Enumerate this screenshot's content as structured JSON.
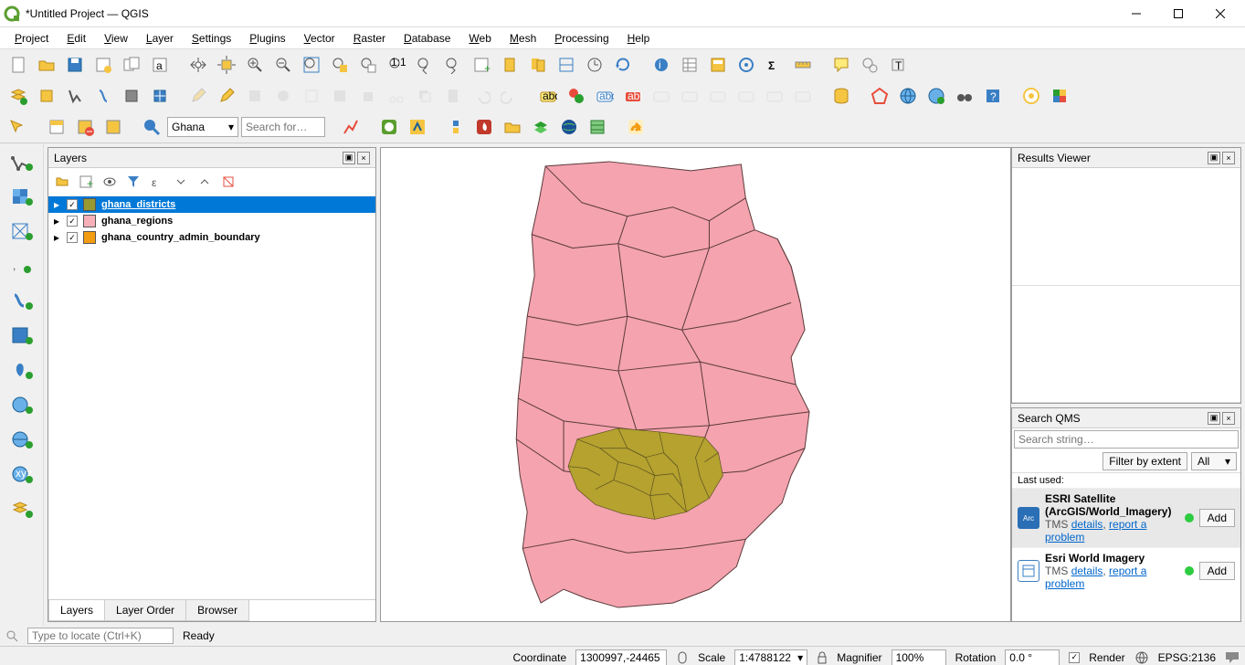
{
  "window": {
    "title": "*Untitled Project — QGIS"
  },
  "menu": [
    "Project",
    "Edit",
    "View",
    "Layer",
    "Settings",
    "Plugins",
    "Vector",
    "Raster",
    "Database",
    "Web",
    "Mesh",
    "Processing",
    "Help"
  ],
  "locator": {
    "placeholder": "Type to locate (Ctrl+K)",
    "status": "Ready"
  },
  "search_combo": {
    "value": "Ghana",
    "placeholder": "Search for…"
  },
  "layers_panel": {
    "title": "Layers",
    "tabs": [
      "Layers",
      "Layer Order",
      "Browser"
    ],
    "items": [
      {
        "checked": true,
        "color": "#999933",
        "name": "ghana_districts",
        "selected": true
      },
      {
        "checked": true,
        "color": "#f7b0b8",
        "name": "ghana_regions",
        "selected": false
      },
      {
        "checked": true,
        "color": "#f39c12",
        "name": "ghana_country_admin_boundary",
        "selected": false
      }
    ]
  },
  "results_panel": {
    "title": "Results Viewer"
  },
  "qms_panel": {
    "title": "Search QMS",
    "search_placeholder": "Search string…",
    "filter_label": "Filter by extent",
    "filter_all": "All",
    "last_used": "Last used:",
    "add_label": "Add",
    "details_label": "details",
    "report_label": "report a problem",
    "tms_label": "TMS",
    "items": [
      {
        "name": "ESRI Satellite (ArcGIS/World_Imagery)"
      },
      {
        "name": "Esri World Imagery"
      }
    ]
  },
  "status": {
    "coord_label": "Coordinate",
    "coord_value": "1300997,-24465",
    "scale_label": "Scale",
    "scale_value": "1:4788122",
    "mag_label": "Magnifier",
    "mag_value": "100%",
    "rot_label": "Rotation",
    "rot_value": "0.0 °",
    "render_label": "Render",
    "crs": "EPSG:2136"
  }
}
